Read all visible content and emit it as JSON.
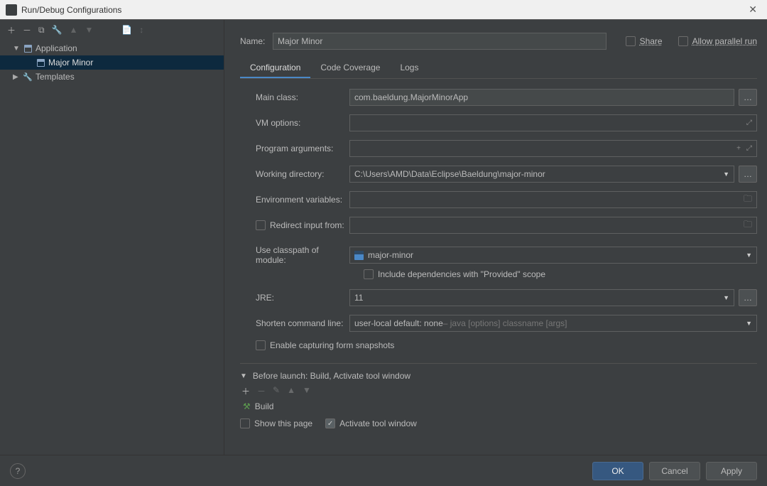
{
  "window_title": "Run/Debug Configurations",
  "tree": {
    "application": "Application",
    "config_name": "Major Minor",
    "templates": "Templates"
  },
  "name_label": "Name:",
  "name_value": "Major Minor",
  "share_label": "Share",
  "allow_parallel_label": "Allow parallel run",
  "tabs": {
    "config": "Configuration",
    "coverage": "Code Coverage",
    "logs": "Logs"
  },
  "form": {
    "main_class_label": "Main class:",
    "main_class_value": "com.baeldung.MajorMinorApp",
    "vm_options_label": "VM options:",
    "vm_options_value": "",
    "program_args_label": "Program arguments:",
    "program_args_value": "",
    "working_dir_label": "Working directory:",
    "working_dir_value": "C:\\Users\\AMD\\Data\\Eclipse\\Baeldung\\major-minor",
    "env_vars_label": "Environment variables:",
    "env_vars_value": "",
    "redirect_label": "Redirect input from:",
    "classpath_label": "Use classpath of module:",
    "classpath_value": "major-minor",
    "include_deps_label": "Include dependencies with \"Provided\" scope",
    "jre_label": "JRE:",
    "jre_value": "11",
    "shorten_label": "Shorten command line:",
    "shorten_value": "user-local default: none",
    "shorten_hint": " – java [options] classname [args]",
    "enable_snapshots_label": "Enable capturing form snapshots"
  },
  "before_launch": {
    "header": "Before launch: Build, Activate tool window",
    "item": "Build",
    "show_page_label": "Show this page",
    "activate_label": "Activate tool window"
  },
  "buttons": {
    "ok": "OK",
    "cancel": "Cancel",
    "apply": "Apply"
  }
}
